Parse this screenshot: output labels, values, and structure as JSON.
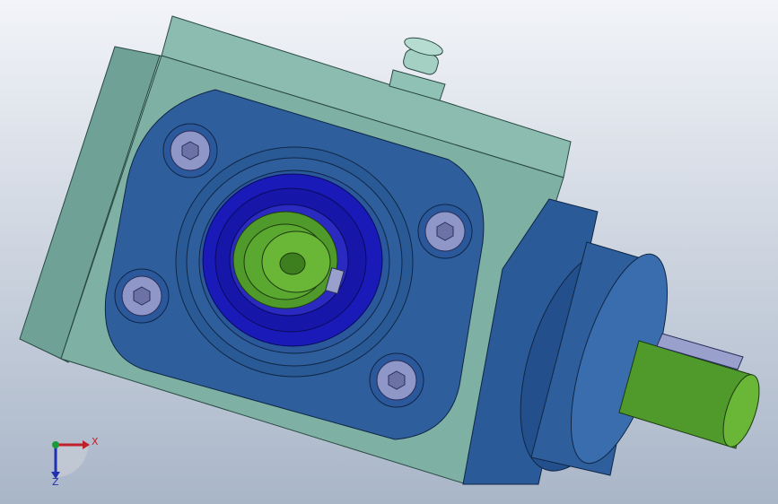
{
  "viewport": {
    "background_top": "#f2f4f8",
    "background_bottom": "#a9b6c8"
  },
  "model": {
    "colors": {
      "housing": "#7fb0a4",
      "housing_dark": "#5d8f84",
      "flange": "#2e5f9c",
      "flange_dark": "#1e4478",
      "bearing_ring": "#1a1ab8",
      "shaft_green": "#4f9a2a",
      "shaft_green_light": "#7cc040",
      "bolt": "#8f96c8",
      "key": "#9aa0cc"
    },
    "bolt_count": 4
  },
  "triad": {
    "x_label": "X",
    "z_label": "Z",
    "x_color": "#c0202a",
    "y_color": "#1e9a3a",
    "z_color": "#2030b0"
  }
}
